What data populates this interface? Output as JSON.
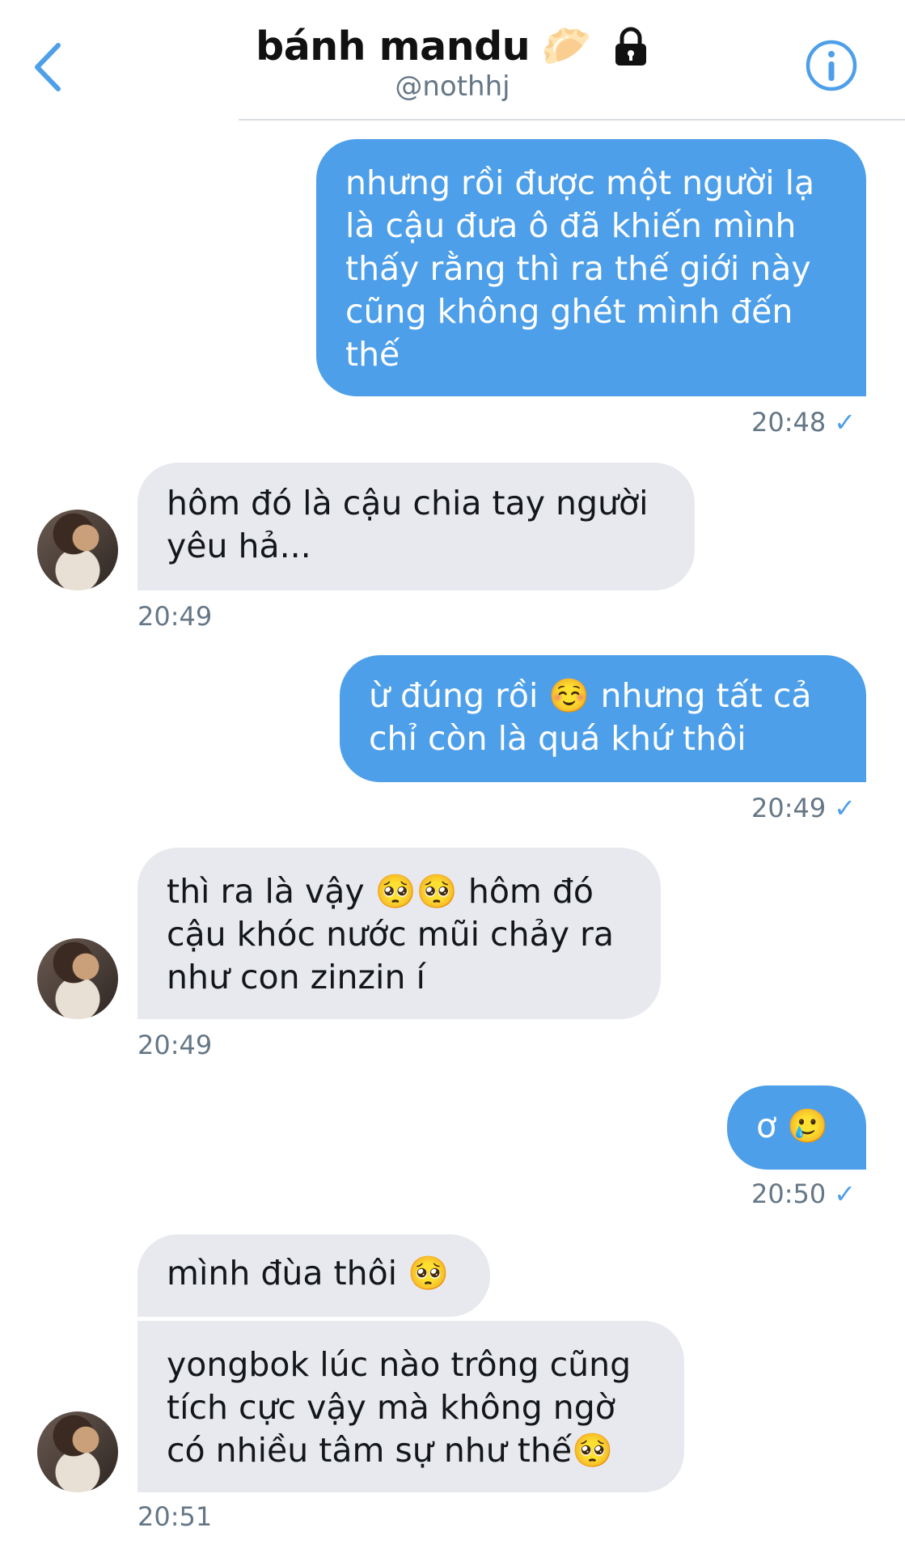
{
  "header": {
    "title": "bánh mandu",
    "title_emoji": "🥟",
    "handle": "@nothhj",
    "back_icon": "chevron-left-icon",
    "info_icon": "info-icon",
    "lock_icon": "lock-icon",
    "accent": "#4d9fe9"
  },
  "messages": [
    {
      "side": "out",
      "text": "nhưng rồi được một người lạ là cậu đưa ô đã khiến mình thấy rằng thì ra thế giới này cũng không ghét mình đến thế",
      "time": "20:48",
      "check": "✓"
    },
    {
      "side": "in",
      "text": "hôm đó là cậu chia tay người yêu hả...",
      "time": "20:49"
    },
    {
      "side": "out",
      "text": "ừ đúng rồi ☺️ nhưng tất cả chỉ còn là quá khứ thôi",
      "time": "20:49",
      "check": "✓"
    },
    {
      "side": "in",
      "text": "thì ra là vậy 🥺🥺 hôm đó cậu khóc nước mũi chảy ra như con zinzin í",
      "time": "20:49"
    },
    {
      "side": "out",
      "text": "ơ 🥲",
      "time": "20:50",
      "check": "✓"
    },
    {
      "side": "in",
      "text": "mình đùa thôi 🥺"
    },
    {
      "side": "in",
      "text": "yongbok lúc nào trông cũng tích cực vậy mà không ngờ có nhiều tâm sự như thế🥺",
      "time": "20:51"
    }
  ],
  "colors": {
    "outgoing": "#4d9fe9",
    "incoming": "#e7e9ee",
    "meta": "#657786"
  }
}
